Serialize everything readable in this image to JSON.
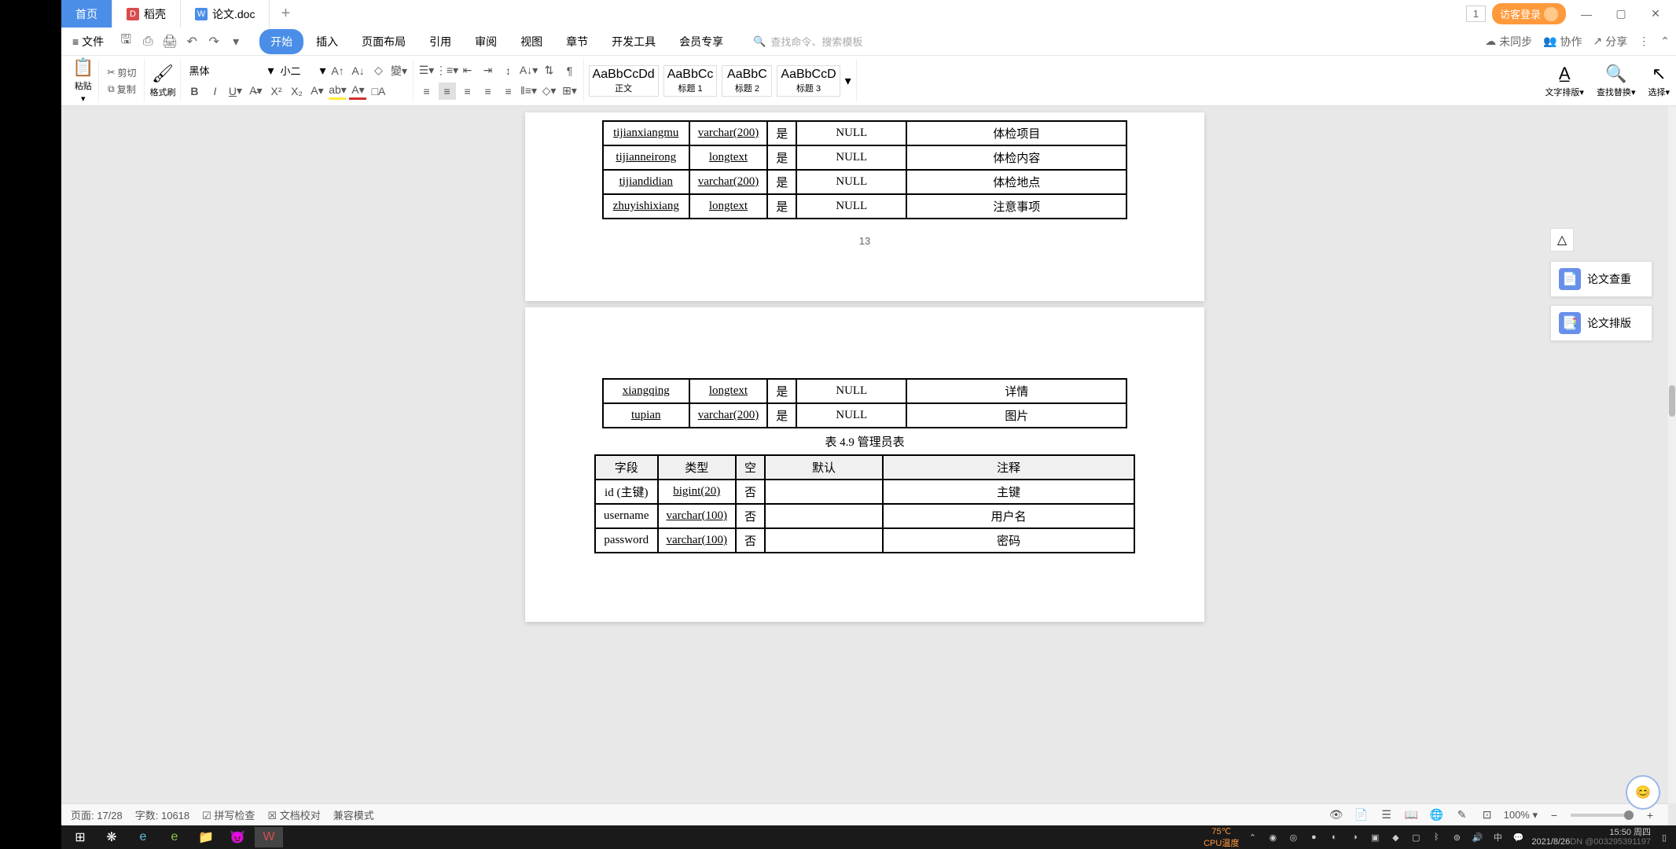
{
  "tabs": {
    "home": "首页",
    "dock": "稻壳",
    "doc": "论文.doc"
  },
  "login": "访客登录",
  "window_num": "1",
  "menu": {
    "file": "文件",
    "tabs": [
      "开始",
      "插入",
      "页面布局",
      "引用",
      "审阅",
      "视图",
      "章节",
      "开发工具",
      "会员专享"
    ],
    "search_ph": "查找命令、搜索模板",
    "unsync": "未同步",
    "collab": "协作",
    "share": "分享"
  },
  "toolbar": {
    "paste": "粘贴",
    "cut": "剪切",
    "copy": "复制",
    "fmt": "格式刷",
    "font": "黑体",
    "size": "小二",
    "bodytext": "正文",
    "h1": "标题 1",
    "h2": "标题 2",
    "h3": "标题 3",
    "text_layout": "文字排版",
    "find_replace": "查找替换",
    "select": "选择"
  },
  "styles_sample": [
    "AaBbCcDd",
    "AaBbCc",
    "AaBbC",
    "AaBbCcD"
  ],
  "side": {
    "check": "论文查重",
    "layout": "论文排版"
  },
  "page1": {
    "rows": [
      {
        "c1": "tijianxiangmu",
        "c2": "varchar(200)",
        "c3": "是",
        "c4": "NULL",
        "c5": "体检项目"
      },
      {
        "c1": "tijianneirong",
        "c2": "longtext",
        "c3": "是",
        "c4": "NULL",
        "c5": "体检内容"
      },
      {
        "c1": "tijiandidian",
        "c2": "varchar(200)",
        "c3": "是",
        "c4": "NULL",
        "c5": "体检地点"
      },
      {
        "c1": "zhuyishixiang",
        "c2": "longtext",
        "c3": "是",
        "c4": "NULL",
        "c5": "注意事项"
      }
    ],
    "page_num": "13"
  },
  "page2": {
    "rows_top": [
      {
        "c1": "xiangqing",
        "c2": "longtext",
        "c3": "是",
        "c4": "NULL",
        "c5": "详情"
      },
      {
        "c1": "tupian",
        "c2": "varchar(200)",
        "c3": "是",
        "c4": "NULL",
        "c5": "图片"
      }
    ],
    "caption": "表 4.9  管理员表",
    "headers": {
      "c1": "字段",
      "c2": "类型",
      "c3": "空",
      "c4": "默认",
      "c5": "注释"
    },
    "rows": [
      {
        "c1": "id (主键)",
        "c2": "bigint(20)",
        "c3": "否",
        "c4": "",
        "c5": "主键"
      },
      {
        "c1": "username",
        "c2": "varchar(100)",
        "c3": "否",
        "c4": "",
        "c5": "用户名"
      },
      {
        "c1": "password",
        "c2": "varchar(100)",
        "c3": "否",
        "c4": "",
        "c5": "密码"
      }
    ]
  },
  "status": {
    "page": "页面: 17/28",
    "words": "字数: 10618",
    "spell": "拼写检查",
    "proof": "文档校对",
    "compat": "兼容模式",
    "zoom": "100%"
  },
  "taskbar": {
    "temp": "75℃",
    "temp_label": "CPU温度",
    "time": "15:50",
    "day": "周四",
    "date": "2021/8/26",
    "watermark": "DN @003295391197"
  }
}
